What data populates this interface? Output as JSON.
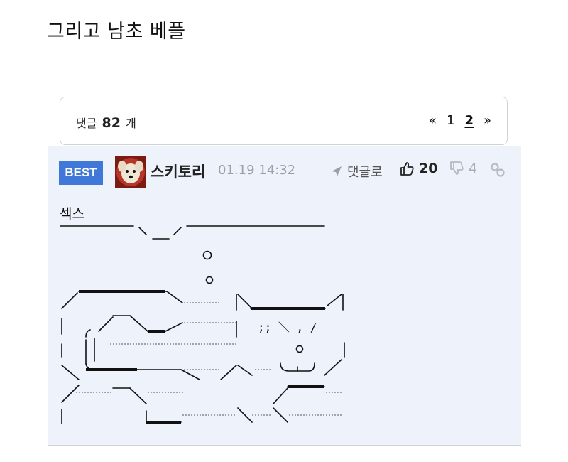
{
  "post": {
    "title": "그리고 남초 베플"
  },
  "comments_header": {
    "label_prefix": "댓글",
    "count": "82",
    "label_suffix": "개",
    "pager": {
      "prev": "«",
      "pages": [
        "1",
        "2"
      ],
      "current": "2",
      "next": "»"
    }
  },
  "comment": {
    "badge": "BEST",
    "nickname": "스키토리",
    "timestamp": "01.19 14:32",
    "reply_label": "댓글로",
    "likes": "20",
    "dislikes": "4",
    "text": "섹스",
    "icons": [
      "avatar-dog",
      "send-arrow-icon",
      "thumbs-up-icon",
      "thumbs-down-icon",
      "link-icon"
    ],
    "colors": {
      "badge": "#3f78d9",
      "background": "#eef3fb"
    }
  }
}
